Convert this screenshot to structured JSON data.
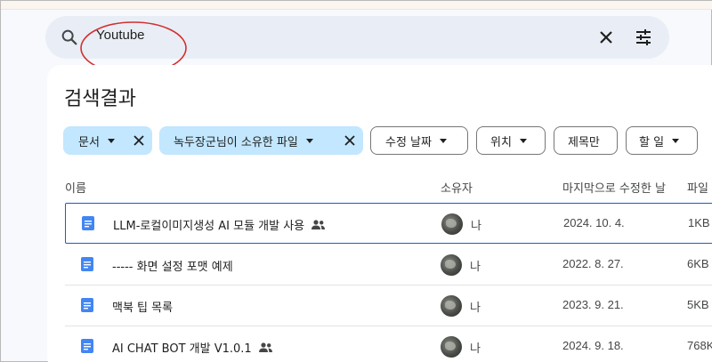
{
  "search": {
    "query": "Youtube"
  },
  "page_title": "검색결과",
  "filters": [
    {
      "label": "문서",
      "selected": true
    },
    {
      "label": "녹두장군님이 소유한 파일",
      "selected": true
    },
    {
      "label": "수정 날짜",
      "selected": false
    },
    {
      "label": "위치",
      "selected": false
    },
    {
      "label": "제목만",
      "selected": false
    },
    {
      "label": "할 일",
      "selected": false
    }
  ],
  "columns": {
    "name": "이름",
    "owner": "소유자",
    "modified": "마지막으로 수정한 날",
    "size": "파일"
  },
  "rows": [
    {
      "name": "LLM-로컬이미지생성 AI 모듈 개발 사용",
      "shared": true,
      "owner": "나",
      "date": "2024. 10. 4.",
      "size": "1KB"
    },
    {
      "name": "----- 화면 설정 포맷 예제",
      "shared": false,
      "owner": "나",
      "date": "2022. 8. 27.",
      "size": "6KB"
    },
    {
      "name": "맥북 팁 목록",
      "shared": false,
      "owner": "나",
      "date": "2023. 9. 21.",
      "size": "5KB"
    },
    {
      "name": "AI CHAT BOT 개발 V1.0.1",
      "shared": true,
      "owner": "나",
      "date": "2024. 9. 18.",
      "size": "768K"
    }
  ],
  "icons": {
    "search": "search-icon",
    "clear": "close-icon",
    "tune": "tune-icon",
    "doc": "google-docs-icon",
    "shared": "people-icon"
  },
  "colors": {
    "accent_chip": "#c2e7ff",
    "doc_blue": "#4285f4",
    "annotation": "#d32f2f",
    "active_row_border": "#1a5ec2"
  }
}
